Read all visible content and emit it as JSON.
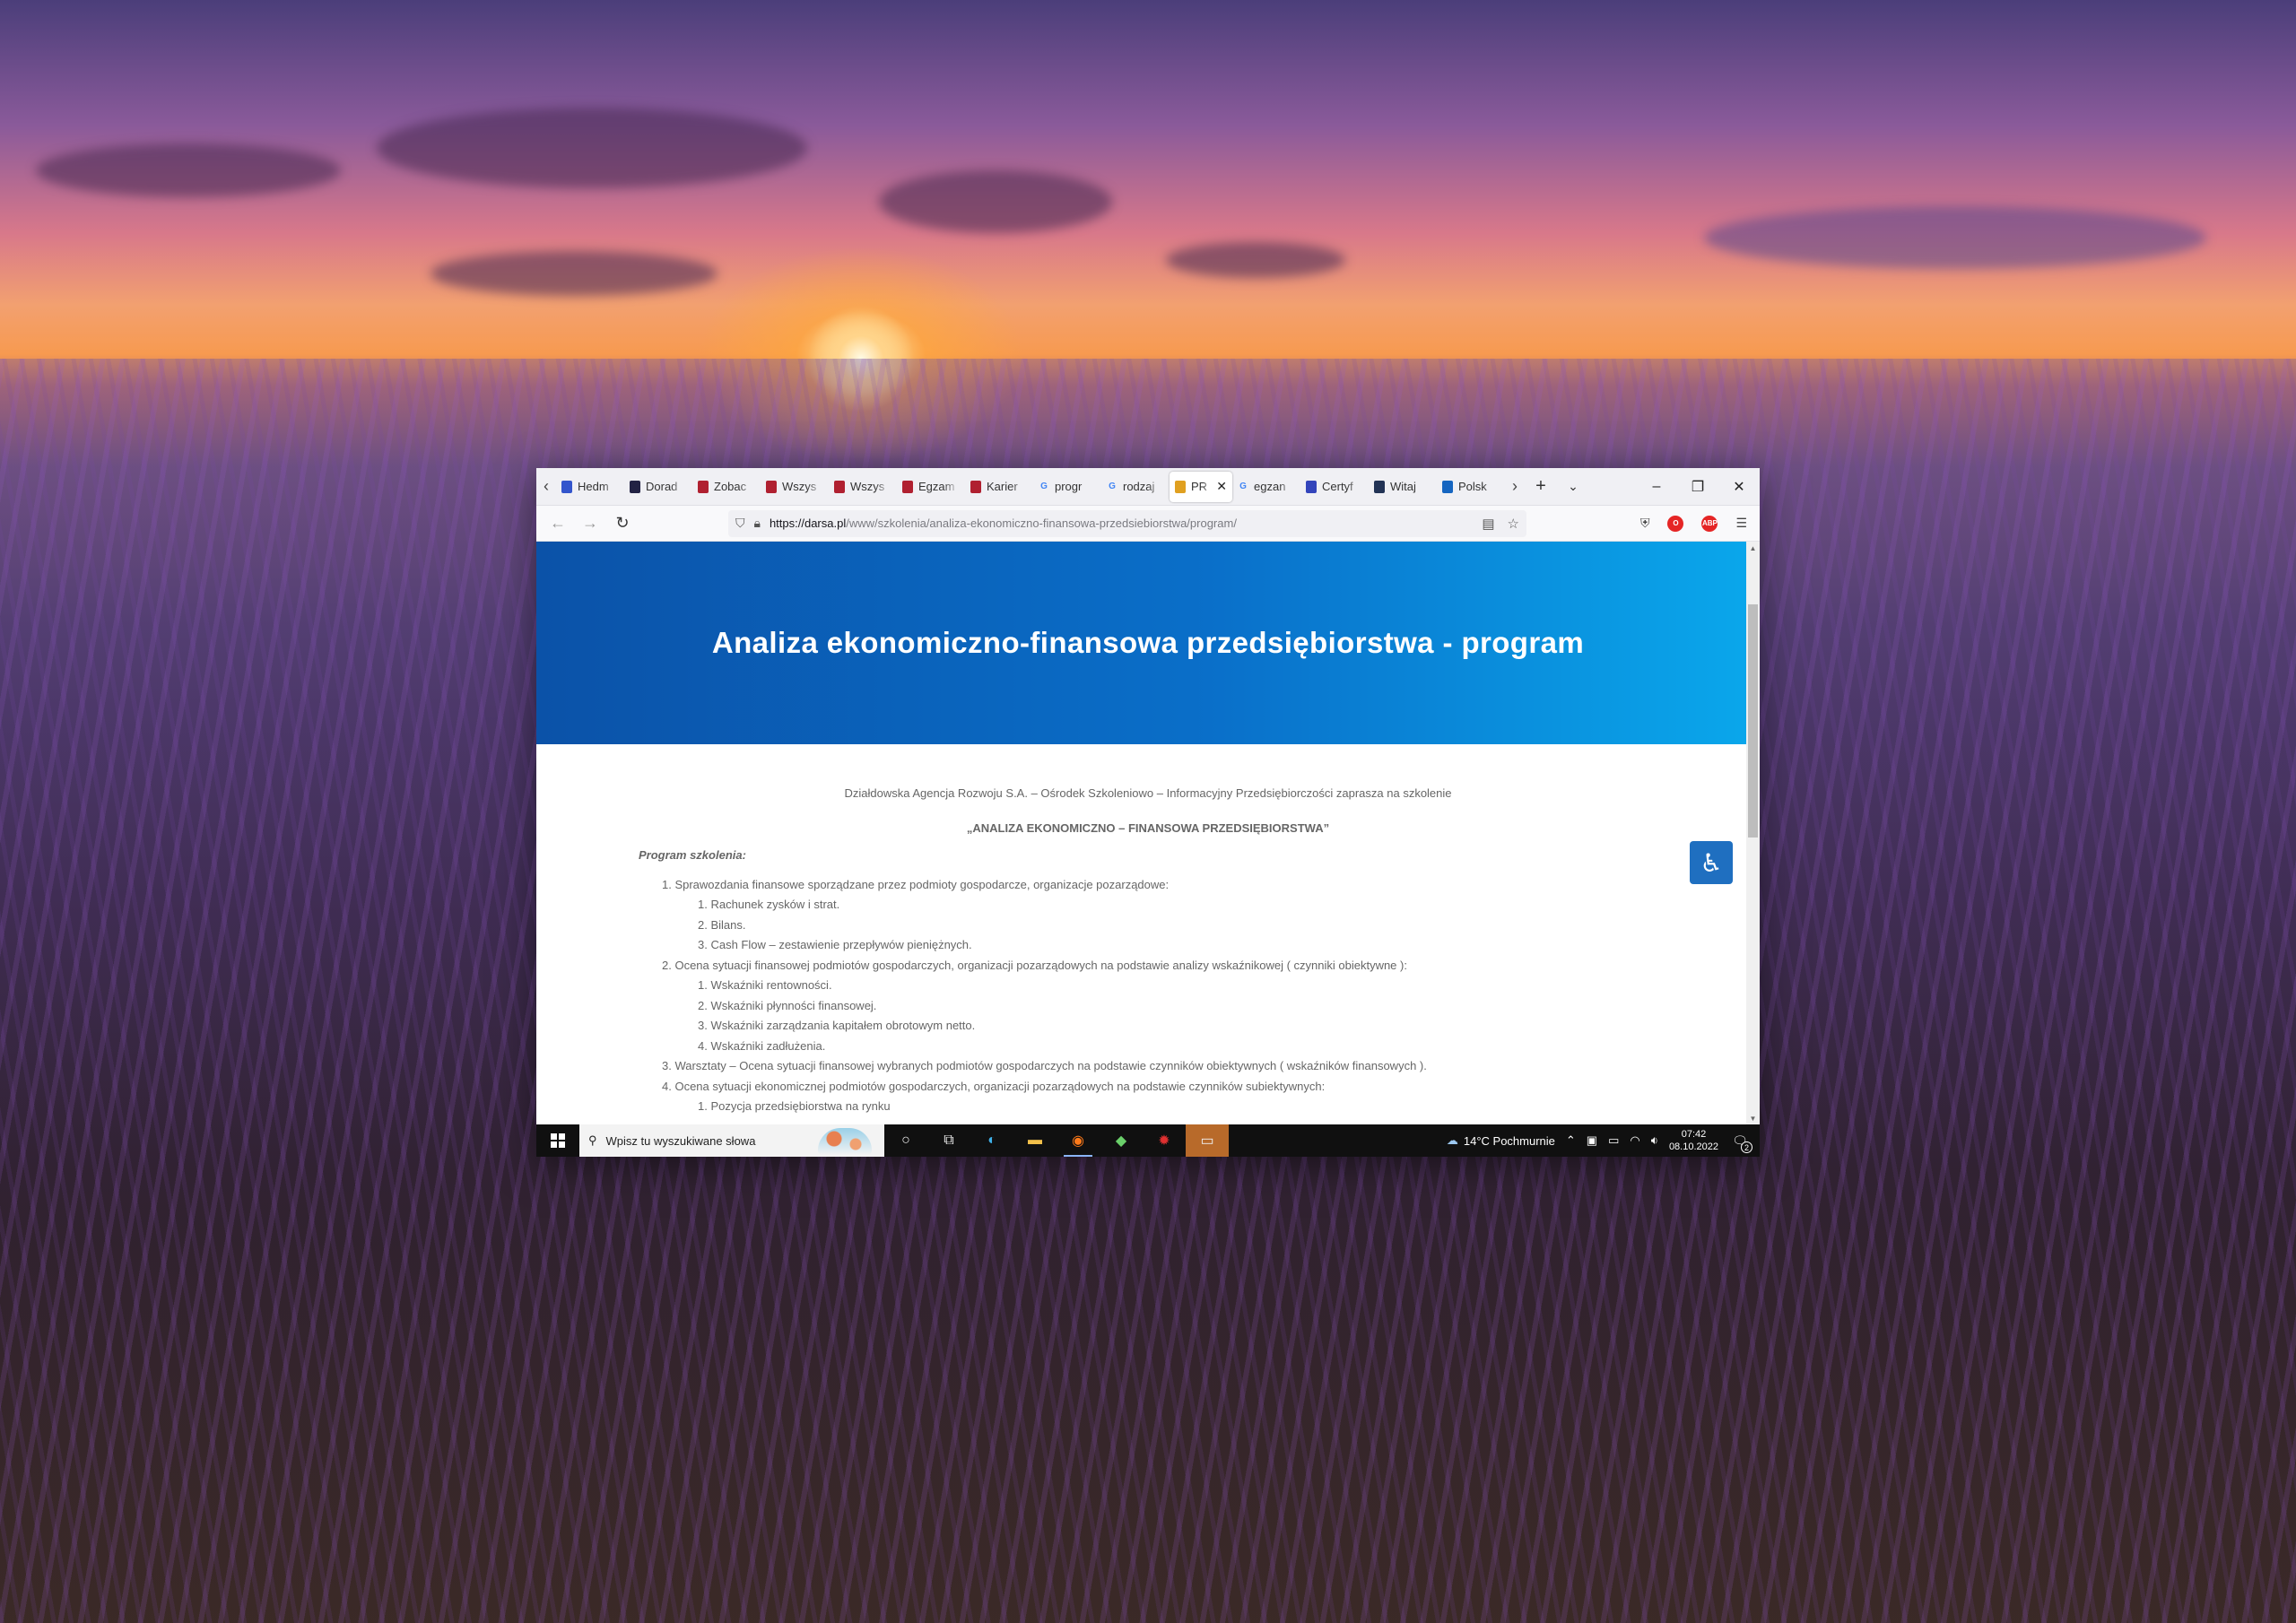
{
  "browser": {
    "tabs": [
      {
        "label": "Hedm",
        "favicon_color": "#3355cc"
      },
      {
        "label": "Dorad",
        "favicon_color": "#222244"
      },
      {
        "label": "Zobac",
        "favicon_color": "#b02030"
      },
      {
        "label": "Wszys",
        "favicon_color": "#b02030"
      },
      {
        "label": "Wszys",
        "favicon_color": "#b02030"
      },
      {
        "label": "Egzam",
        "favicon_color": "#b02030"
      },
      {
        "label": "Karier",
        "favicon_color": "#b02030"
      },
      {
        "label": "progr",
        "favicon_color": "#4285f4",
        "glyph": "G"
      },
      {
        "label": "rodzaj",
        "favicon_color": "#4285f4",
        "glyph": "G"
      },
      {
        "label": "PR",
        "favicon_color": "#e0a020",
        "active": true
      },
      {
        "label": "egzan",
        "favicon_color": "#4285f4",
        "glyph": "G"
      },
      {
        "label": "Certyf",
        "favicon_color": "#3344bb"
      },
      {
        "label": "Witaj",
        "favicon_color": "#223355"
      },
      {
        "label": "Polsk",
        "favicon_color": "#1565c0"
      }
    ],
    "url_host": "https://darsa.pl",
    "url_path": "/www/szkolenia/analiza-ekonomiczno-finansowa-przedsiebiorstwa/program/"
  },
  "page": {
    "hero_title": "Analiza ekonomiczno-finansowa przedsiębiorstwa - program",
    "intro": "Działdowska Agencja Rozwoju S.A. – Ośrodek Szkoleniowo – Informacyjny Przedsiębiorczości zaprasza na szkolenie",
    "course_title": "„ANALIZA EKONOMICZNO – FINANSOWA PRZEDSIĘBIORSTWA”",
    "program_label": "Program szkolenia:",
    "items": [
      {
        "level": 1,
        "text": "1. Sprawozdania finansowe sporządzane przez podmioty gospodarcze, organizacje pozarządowe:"
      },
      {
        "level": 2,
        "text": "1. Rachunek zysków i strat."
      },
      {
        "level": 2,
        "text": "2. Bilans."
      },
      {
        "level": 2,
        "text": "3. Cash Flow – zestawienie przepływów pieniężnych."
      },
      {
        "level": 1,
        "text": "2. Ocena sytuacji  finansowej  podmiotów gospodarczych, organizacji pozarządowych na podstawie analizy wskaźnikowej ( czynniki obiektywne ):"
      },
      {
        "level": 2,
        "text": "1. Wskaźniki rentowności."
      },
      {
        "level": 2,
        "text": "2. Wskaźniki płynności finansowej."
      },
      {
        "level": 2,
        "text": "3. Wskaźniki zarządzania kapitałem obrotowym netto."
      },
      {
        "level": 2,
        "text": "4. Wskaźniki zadłużenia."
      },
      {
        "level": 1,
        "text": "3. Warsztaty – Ocena sytuacji finansowej wybranych podmiotów gospodarczych na podstawie czynników obiektywnych ( wskaźników finansowych )."
      },
      {
        "level": 1,
        "text": "4.  Ocena sytuacji ekonomicznej podmiotów gospodarczych, organizacji pozarządowych na podstawie czynników  subiektywnych:"
      },
      {
        "level": 2,
        "text": "1. Pozycja przedsiębiorstwa na rynku"
      }
    ]
  },
  "taskbar": {
    "search_placeholder": "Wpisz tu wyszukiwane słowa",
    "weather": "14°C  Pochmurnie",
    "time": "07:42",
    "date": "08.10.2022",
    "notifications": "2"
  },
  "colors": {
    "hero_start": "#0b52a8",
    "hero_end": "#0aa8ec",
    "accessibility_button": "#1f6fc0"
  }
}
